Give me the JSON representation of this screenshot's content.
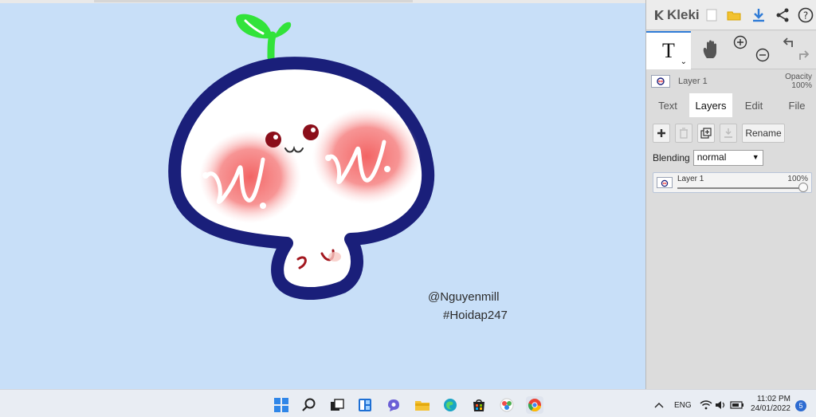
{
  "app": {
    "name": "Kleki"
  },
  "canvas": {
    "watermark_line1": "@Nguyenmill",
    "watermark_line2": "#Hoidap247"
  },
  "toolbar": {
    "active_tool_glyph": "T",
    "dropdown_glyph": "⌄"
  },
  "layer_preview": {
    "name": "Layer 1",
    "opacity_label": "Opacity",
    "opacity_value": "100%"
  },
  "tabs": [
    {
      "label": "Text"
    },
    {
      "label": "Layers",
      "active": true
    },
    {
      "label": "Edit"
    },
    {
      "label": "File"
    }
  ],
  "layers_panel": {
    "rename_label": "Rename",
    "blending_label": "Blending",
    "blending_value": "normal",
    "layers": [
      {
        "name": "Layer 1",
        "opacity": "100%",
        "opacity_fraction": 1.0
      }
    ]
  },
  "taskbar": {
    "language": "ENG",
    "time": "11:02 PM",
    "date": "24/01/2022",
    "notifications": "5"
  },
  "colors": {
    "accent": "#2f7bd6",
    "canvas_bg": "#c8dff8",
    "outline": "#1a1f7a",
    "sprout": "#32e33a",
    "cheek": "#f36b6b"
  }
}
